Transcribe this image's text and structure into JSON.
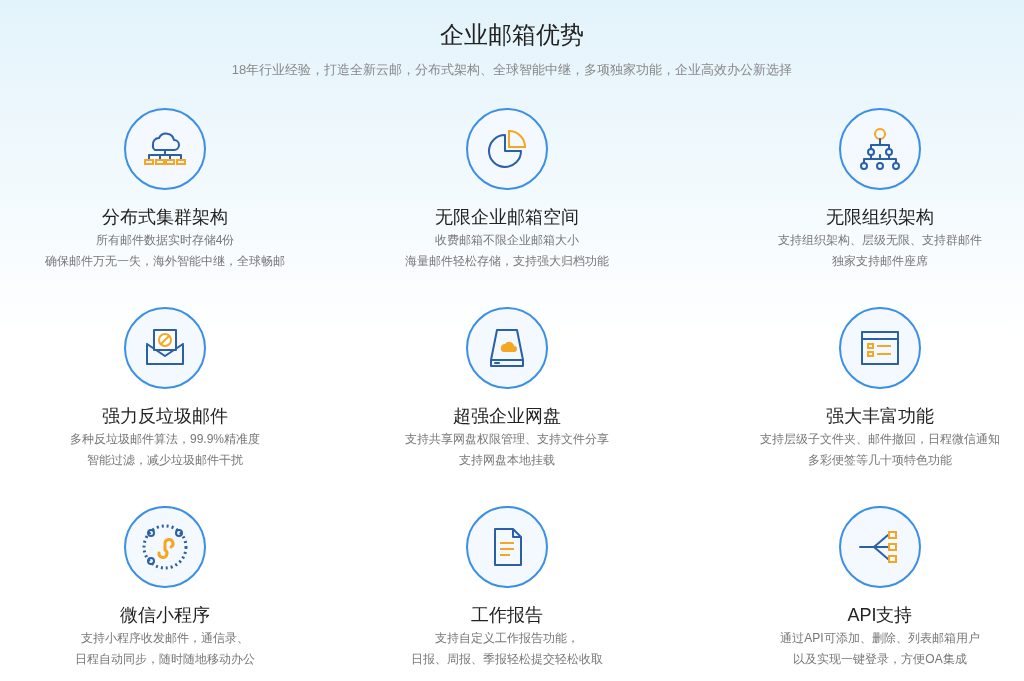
{
  "header": {
    "title": "企业邮箱优势",
    "subtitle": "18年行业经验，打造全新云邮，分布式架构、全球智能中继，多项独家功能，企业高效办公新选择"
  },
  "features": [
    {
      "kind": "cloud",
      "title": "分布式集群架构",
      "lines": [
        "所有邮件数据实时存储4份",
        "确保邮件万无一失，海外智能中继，全球畅邮"
      ]
    },
    {
      "kind": "pie",
      "title": "无限企业邮箱空间",
      "lines": [
        "收费邮箱不限企业邮箱大小",
        "海量邮件轻松存储，支持强大归档功能"
      ]
    },
    {
      "kind": "org",
      "title": "无限组织架构",
      "lines": [
        "支持组织架构、层级无限、支持群邮件",
        "独家支持邮件座席"
      ]
    },
    {
      "kind": "spam",
      "title": "强力反垃圾邮件",
      "lines": [
        "多种反垃圾邮件算法，99.9%精准度",
        "智能过滤，减少垃圾邮件干扰"
      ]
    },
    {
      "kind": "disk",
      "title": "超强企业网盘",
      "lines": [
        "支持共享网盘权限管理、支持文件分享",
        "支持网盘本地挂载"
      ]
    },
    {
      "kind": "window",
      "title": "强大丰富功能",
      "lines": [
        "支持层级子文件夹、邮件撤回，日程微信通知",
        "多彩便签等几十项特色功能"
      ]
    },
    {
      "kind": "miniapp",
      "title": "微信小程序",
      "lines": [
        "支持小程序收发邮件，通信录、",
        "日程自动同步，随时随地移动办公"
      ]
    },
    {
      "kind": "report",
      "title": "工作报告",
      "lines": [
        "支持自定义工作报告功能，",
        "日报、周报、季报轻松提交轻松收取"
      ]
    },
    {
      "kind": "api",
      "title": "API支持",
      "lines": [
        "通过API可添加、删除、列表邮箱用户",
        "以及实现一键登录，方便OA集成"
      ]
    }
  ]
}
